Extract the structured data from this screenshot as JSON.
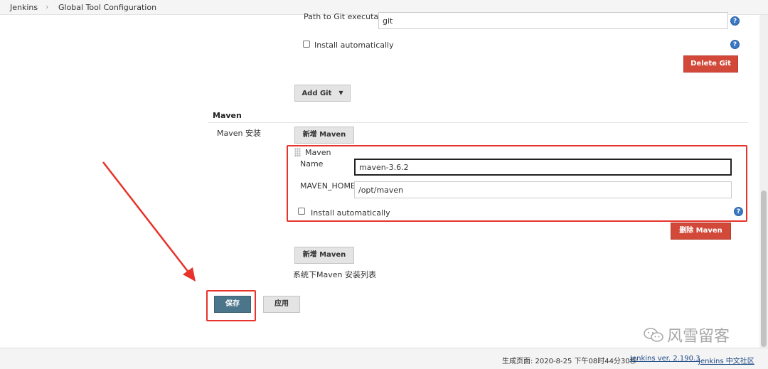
{
  "breadcrumb": {
    "home": "Jenkins",
    "separator": "›",
    "current": "Global Tool Configuration"
  },
  "git": {
    "path_label": "Path to Git executable",
    "path_value": "git",
    "install_auto_label": "Install automatically",
    "delete_button": "Delete Git",
    "add_button": "Add Git"
  },
  "maven": {
    "section_title": "Maven",
    "install_label": "Maven 安装",
    "add_top_button": "新增 Maven",
    "installation": {
      "title": "Maven",
      "name_label": "Name",
      "name_value": "maven-3.6.2",
      "home_label": "MAVEN_HOME",
      "home_value": "/opt/maven",
      "install_auto_label": "Install automatically",
      "delete_button": "删除 Maven"
    },
    "add_bottom_button": "新增 Maven",
    "list_desc": "系统下Maven 安装列表"
  },
  "actions": {
    "save": "保存",
    "apply": "应用"
  },
  "footer": {
    "generated": "生成页面: 2020-8-25 下午08时44分30秒",
    "version_link": "Jenkins ver. 2.190.3",
    "community_link": "Jenkins 中文社区"
  },
  "watermark": "风雪留客",
  "colors": {
    "annotation_red": "#e8322a",
    "delete_red": "#d24939",
    "save_blue": "#4b758b",
    "help_blue": "#3a78c3"
  },
  "icons": {
    "help": "question-mark-circle-icon",
    "drag": "drag-handle-icon",
    "caret": "caret-down-icon"
  }
}
